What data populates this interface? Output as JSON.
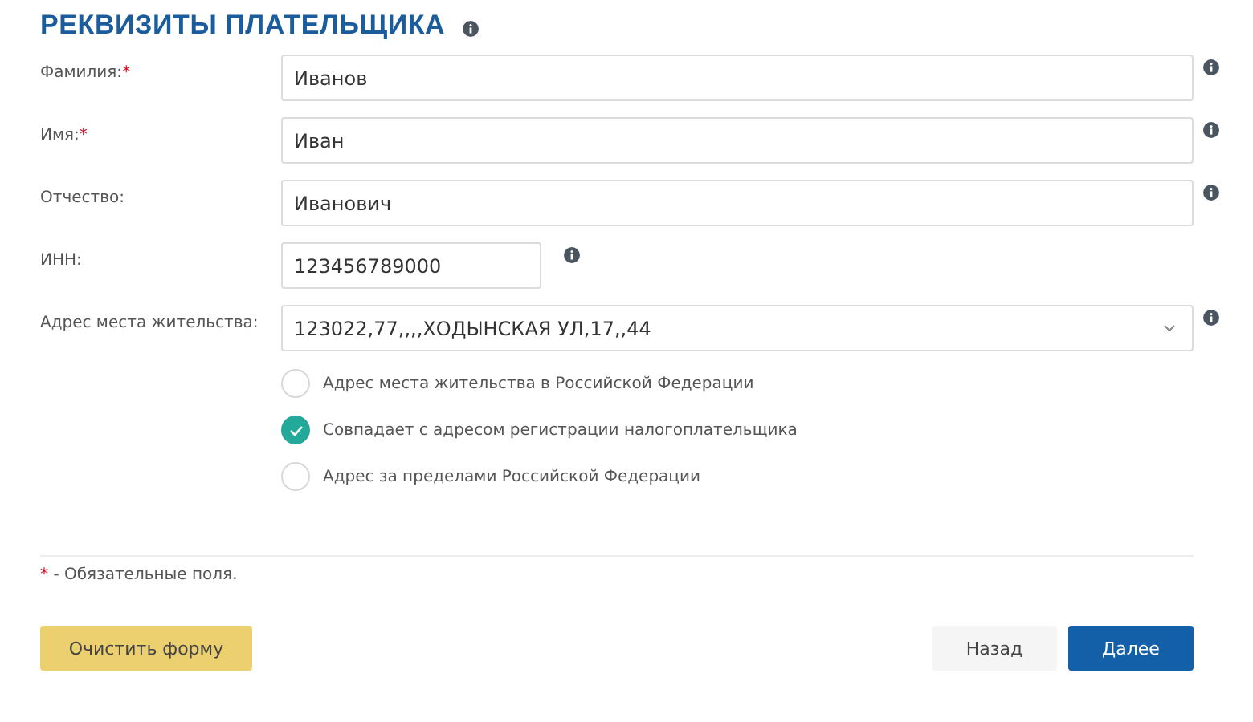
{
  "title": "РЕКВИЗИТЫ ПЛАТЕЛЬЩИКА",
  "fields": [
    {
      "kind": "text",
      "label": "Фамилия:",
      "required_mark": "*",
      "value": "Иванов"
    },
    {
      "kind": "text",
      "label": "Имя:",
      "required_mark": "*",
      "value": "Иван"
    },
    {
      "kind": "text",
      "label": "Отчество:",
      "value": "Иванович"
    },
    {
      "kind": "short",
      "label": "ИНН:",
      "value": "123456789000"
    },
    {
      "kind": "select",
      "label": "Адрес места жительства:",
      "value": "123022,77,,,,ХОДЫНСКАЯ УЛ,17,,44"
    }
  ],
  "address_options": [
    {
      "label": "Адрес места жительства в Российской Федерации",
      "selected": false
    },
    {
      "label": "Совпадает с адресом регистрации налогоплательщика",
      "selected": true
    },
    {
      "label": "Адрес за пределами Российской Федерации",
      "selected": false
    }
  ],
  "footnote": {
    "mark": "*",
    "text": "- Обязательные поля."
  },
  "buttons": [
    {
      "kind": "clear",
      "label": "Очистить форму"
    },
    {
      "kind": "back",
      "label": "Назад"
    },
    {
      "kind": "next",
      "label": "Далее"
    }
  ]
}
